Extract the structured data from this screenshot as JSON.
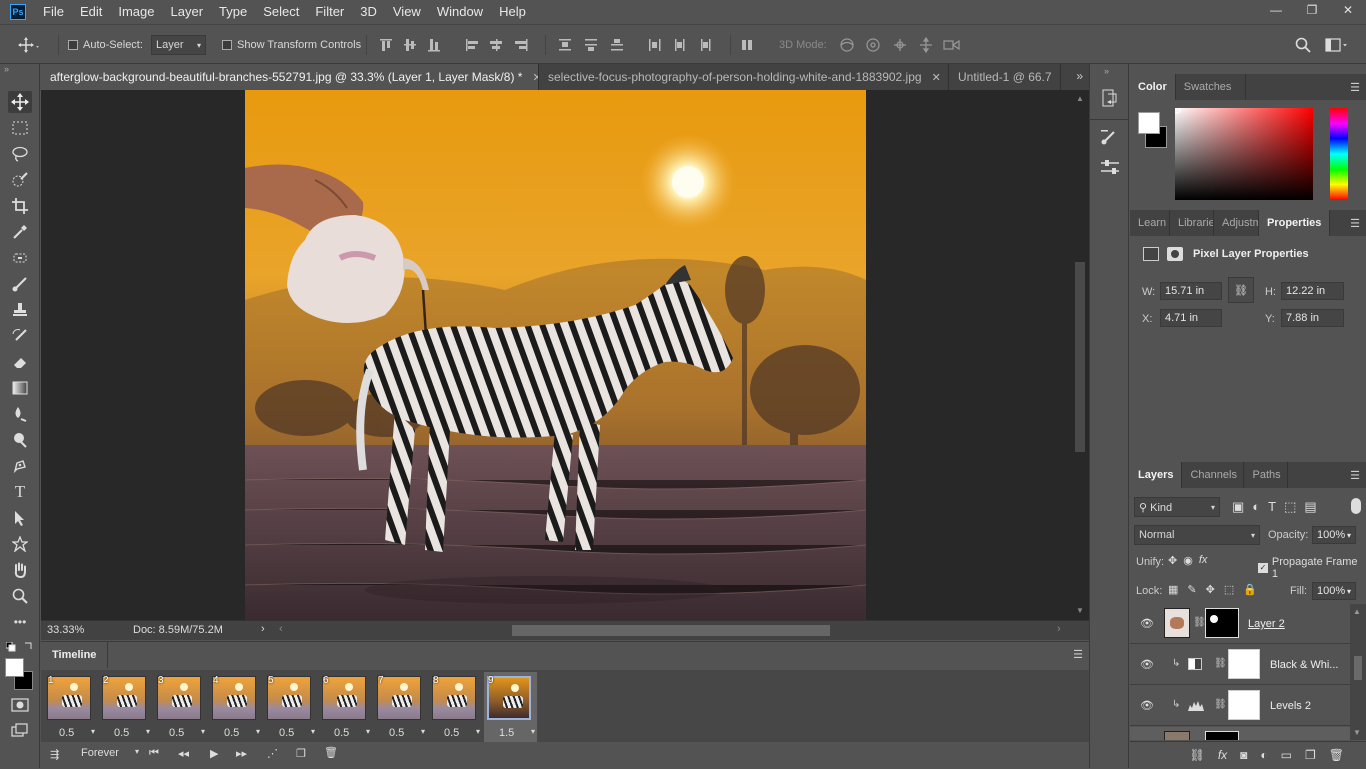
{
  "app": {
    "logo": "Ps"
  },
  "menu": [
    "File",
    "Edit",
    "Image",
    "Layer",
    "Type",
    "Select",
    "Filter",
    "3D",
    "View",
    "Window",
    "Help"
  ],
  "window_controls": {
    "minimize": "—",
    "restore": "❐",
    "close": "✕"
  },
  "options": {
    "auto_select_label": "Auto-Select:",
    "auto_select_value": "Layer",
    "show_transform_label": "Show Transform Controls",
    "mode_3d_label": "3D Mode:"
  },
  "doc_tabs": [
    {
      "label": "afterglow-background-beautiful-branches-552791.jpg @ 33.3% (Layer 1, Layer Mask/8) *",
      "active": true
    },
    {
      "label": "selective-focus-photography-of-person-holding-white-and-1883902.jpg",
      "active": false
    },
    {
      "label": "Untitled-1 @ 66.7",
      "active": false
    }
  ],
  "status": {
    "zoom": "33.33%",
    "doc": "Doc: 8.59M/75.2M"
  },
  "timeline": {
    "tab": "Timeline",
    "frames": [
      {
        "num": "1",
        "delay": "0.5"
      },
      {
        "num": "2",
        "delay": "0.5"
      },
      {
        "num": "3",
        "delay": "0.5"
      },
      {
        "num": "4",
        "delay": "0.5"
      },
      {
        "num": "5",
        "delay": "0.5"
      },
      {
        "num": "6",
        "delay": "0.5"
      },
      {
        "num": "7",
        "delay": "0.5"
      },
      {
        "num": "8",
        "delay": "0.5"
      },
      {
        "num": "9",
        "delay": "1.5"
      }
    ],
    "loop": "Forever"
  },
  "color_panel": {
    "tabs": [
      "Color",
      "Swatches"
    ]
  },
  "properties_panel": {
    "tabs": [
      "Learn",
      "Librarie",
      "Adjustm",
      "Properties"
    ],
    "title": "Pixel Layer Properties",
    "w_label": "W:",
    "w_value": "15.71 in",
    "h_label": "H:",
    "h_value": "12.22 in",
    "x_label": "X:",
    "x_value": "4.71 in",
    "y_label": "Y:",
    "y_value": "7.88 in"
  },
  "layers_panel": {
    "tabs": [
      "Layers",
      "Channels",
      "Paths"
    ],
    "kind": "Kind",
    "blend": "Normal",
    "opacity_label": "Opacity:",
    "opacity": "100%",
    "unify_label": "Unify:",
    "propagate_label": "Propagate Frame 1",
    "lock_label": "Lock:",
    "fill_label": "Fill:",
    "fill": "100%",
    "layers": [
      {
        "name": "Layer 2"
      },
      {
        "name": "Black & Whi..."
      },
      {
        "name": "Levels 2"
      }
    ]
  },
  "colors": {
    "accent": "#31a8ff",
    "bg": "#535353",
    "dark": "#282828"
  }
}
